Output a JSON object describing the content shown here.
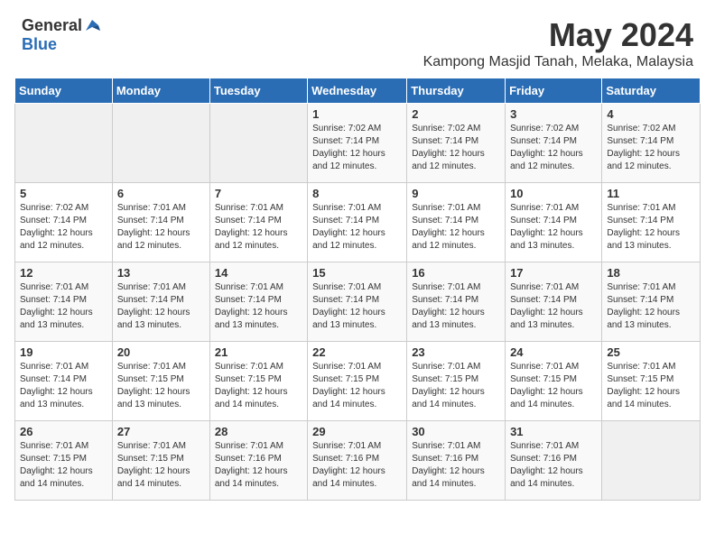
{
  "header": {
    "logo_general": "General",
    "logo_blue": "Blue",
    "month_year": "May 2024",
    "location": "Kampong Masjid Tanah, Melaka, Malaysia"
  },
  "weekdays": [
    "Sunday",
    "Monday",
    "Tuesday",
    "Wednesday",
    "Thursday",
    "Friday",
    "Saturday"
  ],
  "weeks": [
    [
      {
        "day": "",
        "info": ""
      },
      {
        "day": "",
        "info": ""
      },
      {
        "day": "",
        "info": ""
      },
      {
        "day": "1",
        "info": "Sunrise: 7:02 AM\nSunset: 7:14 PM\nDaylight: 12 hours\nand 12 minutes."
      },
      {
        "day": "2",
        "info": "Sunrise: 7:02 AM\nSunset: 7:14 PM\nDaylight: 12 hours\nand 12 minutes."
      },
      {
        "day": "3",
        "info": "Sunrise: 7:02 AM\nSunset: 7:14 PM\nDaylight: 12 hours\nand 12 minutes."
      },
      {
        "day": "4",
        "info": "Sunrise: 7:02 AM\nSunset: 7:14 PM\nDaylight: 12 hours\nand 12 minutes."
      }
    ],
    [
      {
        "day": "5",
        "info": "Sunrise: 7:02 AM\nSunset: 7:14 PM\nDaylight: 12 hours\nand 12 minutes."
      },
      {
        "day": "6",
        "info": "Sunrise: 7:01 AM\nSunset: 7:14 PM\nDaylight: 12 hours\nand 12 minutes."
      },
      {
        "day": "7",
        "info": "Sunrise: 7:01 AM\nSunset: 7:14 PM\nDaylight: 12 hours\nand 12 minutes."
      },
      {
        "day": "8",
        "info": "Sunrise: 7:01 AM\nSunset: 7:14 PM\nDaylight: 12 hours\nand 12 minutes."
      },
      {
        "day": "9",
        "info": "Sunrise: 7:01 AM\nSunset: 7:14 PM\nDaylight: 12 hours\nand 12 minutes."
      },
      {
        "day": "10",
        "info": "Sunrise: 7:01 AM\nSunset: 7:14 PM\nDaylight: 12 hours\nand 13 minutes."
      },
      {
        "day": "11",
        "info": "Sunrise: 7:01 AM\nSunset: 7:14 PM\nDaylight: 12 hours\nand 13 minutes."
      }
    ],
    [
      {
        "day": "12",
        "info": "Sunrise: 7:01 AM\nSunset: 7:14 PM\nDaylight: 12 hours\nand 13 minutes."
      },
      {
        "day": "13",
        "info": "Sunrise: 7:01 AM\nSunset: 7:14 PM\nDaylight: 12 hours\nand 13 minutes."
      },
      {
        "day": "14",
        "info": "Sunrise: 7:01 AM\nSunset: 7:14 PM\nDaylight: 12 hours\nand 13 minutes."
      },
      {
        "day": "15",
        "info": "Sunrise: 7:01 AM\nSunset: 7:14 PM\nDaylight: 12 hours\nand 13 minutes."
      },
      {
        "day": "16",
        "info": "Sunrise: 7:01 AM\nSunset: 7:14 PM\nDaylight: 12 hours\nand 13 minutes."
      },
      {
        "day": "17",
        "info": "Sunrise: 7:01 AM\nSunset: 7:14 PM\nDaylight: 12 hours\nand 13 minutes."
      },
      {
        "day": "18",
        "info": "Sunrise: 7:01 AM\nSunset: 7:14 PM\nDaylight: 12 hours\nand 13 minutes."
      }
    ],
    [
      {
        "day": "19",
        "info": "Sunrise: 7:01 AM\nSunset: 7:14 PM\nDaylight: 12 hours\nand 13 minutes."
      },
      {
        "day": "20",
        "info": "Sunrise: 7:01 AM\nSunset: 7:15 PM\nDaylight: 12 hours\nand 13 minutes."
      },
      {
        "day": "21",
        "info": "Sunrise: 7:01 AM\nSunset: 7:15 PM\nDaylight: 12 hours\nand 14 minutes."
      },
      {
        "day": "22",
        "info": "Sunrise: 7:01 AM\nSunset: 7:15 PM\nDaylight: 12 hours\nand 14 minutes."
      },
      {
        "day": "23",
        "info": "Sunrise: 7:01 AM\nSunset: 7:15 PM\nDaylight: 12 hours\nand 14 minutes."
      },
      {
        "day": "24",
        "info": "Sunrise: 7:01 AM\nSunset: 7:15 PM\nDaylight: 12 hours\nand 14 minutes."
      },
      {
        "day": "25",
        "info": "Sunrise: 7:01 AM\nSunset: 7:15 PM\nDaylight: 12 hours\nand 14 minutes."
      }
    ],
    [
      {
        "day": "26",
        "info": "Sunrise: 7:01 AM\nSunset: 7:15 PM\nDaylight: 12 hours\nand 14 minutes."
      },
      {
        "day": "27",
        "info": "Sunrise: 7:01 AM\nSunset: 7:15 PM\nDaylight: 12 hours\nand 14 minutes."
      },
      {
        "day": "28",
        "info": "Sunrise: 7:01 AM\nSunset: 7:16 PM\nDaylight: 12 hours\nand 14 minutes."
      },
      {
        "day": "29",
        "info": "Sunrise: 7:01 AM\nSunset: 7:16 PM\nDaylight: 12 hours\nand 14 minutes."
      },
      {
        "day": "30",
        "info": "Sunrise: 7:01 AM\nSunset: 7:16 PM\nDaylight: 12 hours\nand 14 minutes."
      },
      {
        "day": "31",
        "info": "Sunrise: 7:01 AM\nSunset: 7:16 PM\nDaylight: 12 hours\nand 14 minutes."
      },
      {
        "day": "",
        "info": ""
      }
    ]
  ]
}
